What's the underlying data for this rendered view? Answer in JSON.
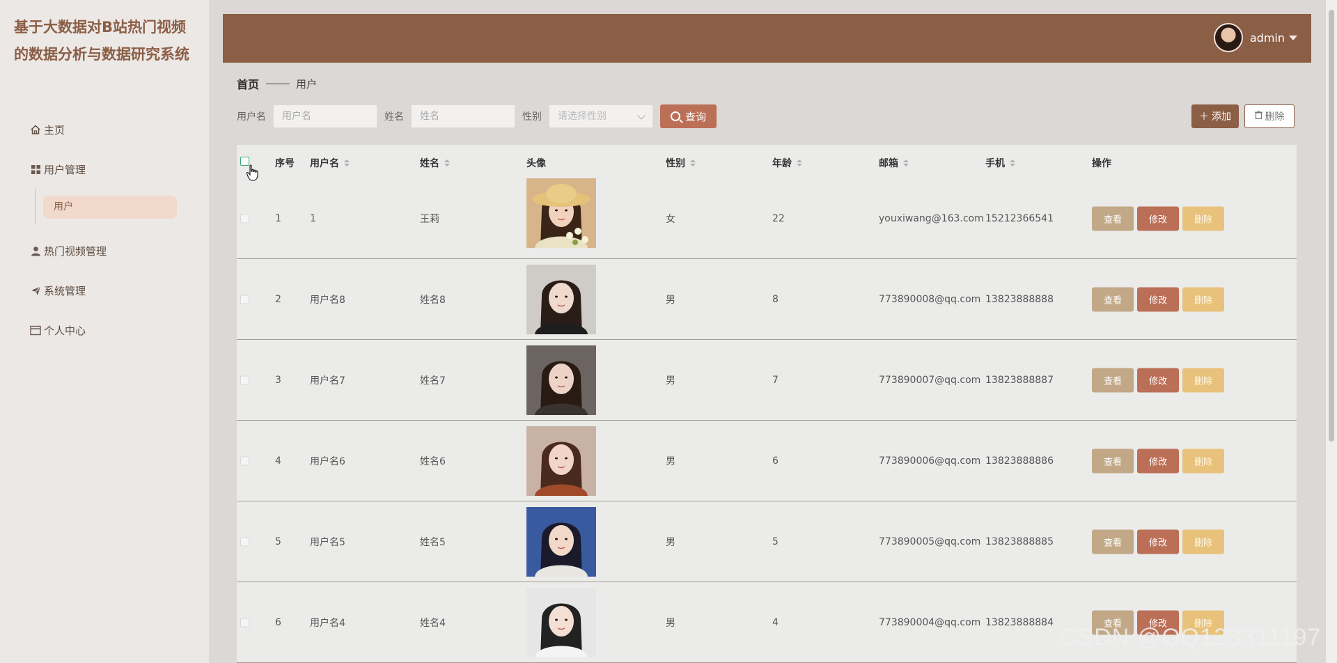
{
  "app": {
    "title": "基于大数据对B站热门视频的数据分析与数据研究系统"
  },
  "sidebar": {
    "items": [
      {
        "label": "主页",
        "icon": "home-icon"
      },
      {
        "label": "用户管理",
        "icon": "grid-icon"
      },
      {
        "label": "热门视频管理",
        "icon": "person-icon"
      },
      {
        "label": "系统管理",
        "icon": "paper-plane-icon"
      },
      {
        "label": "个人中心",
        "icon": "card-icon"
      }
    ],
    "subitems": [
      {
        "label": "用户",
        "active": true
      }
    ]
  },
  "header": {
    "username": "admin",
    "accent": "#8b5e46"
  },
  "breadcrumb": {
    "home": "首页",
    "current": "用户"
  },
  "search": {
    "username_label": "用户名",
    "username_placeholder": "用户名",
    "name_label": "姓名",
    "name_placeholder": "姓名",
    "gender_label": "性别",
    "gender_placeholder": "请选择性别",
    "query_label": "查询"
  },
  "toolbar": {
    "add_label": "添加",
    "delete_label": "删除"
  },
  "table": {
    "headers": {
      "index": "序号",
      "username": "用户名",
      "name": "姓名",
      "avatar": "头像",
      "gender": "性别",
      "age": "年龄",
      "email": "邮箱",
      "phone": "手机",
      "actions": "操作"
    },
    "action_labels": {
      "view": "查看",
      "edit": "修改",
      "delete": "删除"
    },
    "rows": [
      {
        "index": "1",
        "username": "1",
        "name": "王莉",
        "gender": "女",
        "age": "22",
        "email": "youxiwang@163.com",
        "phone": "15212366541"
      },
      {
        "index": "2",
        "username": "用户名8",
        "name": "姓名8",
        "gender": "男",
        "age": "8",
        "email": "773890008@qq.com",
        "phone": "13823888888"
      },
      {
        "index": "3",
        "username": "用户名7",
        "name": "姓名7",
        "gender": "男",
        "age": "7",
        "email": "773890007@qq.com",
        "phone": "13823888887"
      },
      {
        "index": "4",
        "username": "用户名6",
        "name": "姓名6",
        "gender": "男",
        "age": "6",
        "email": "773890006@qq.com",
        "phone": "13823888886"
      },
      {
        "index": "5",
        "username": "用户名5",
        "name": "姓名5",
        "gender": "男",
        "age": "5",
        "email": "773890005@qq.com",
        "phone": "13823888885"
      },
      {
        "index": "6",
        "username": "用户名4",
        "name": "姓名4",
        "gender": "男",
        "age": "4",
        "email": "773890004@qq.com",
        "phone": "13823888884"
      }
    ]
  },
  "watermark": "CSDN @QQ123311197"
}
